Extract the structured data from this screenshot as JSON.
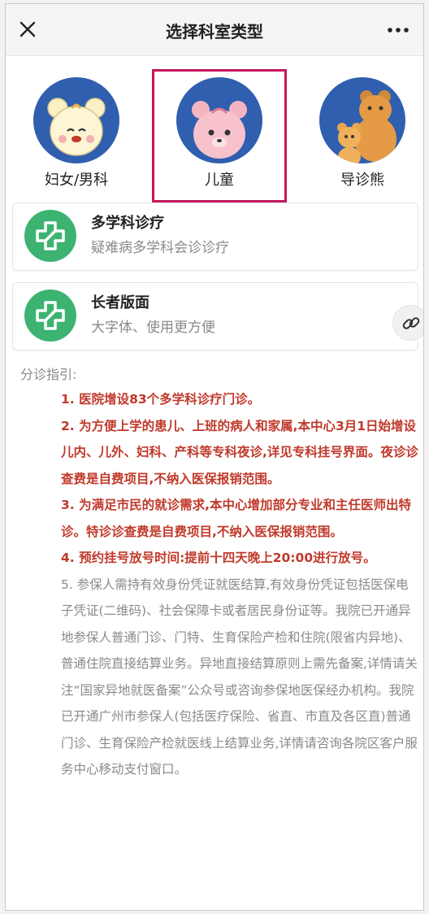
{
  "header": {
    "title": "选择科室类型",
    "close_icon": "close-icon",
    "more_icon": "more-icon"
  },
  "departments": [
    {
      "label": "妇女/男科",
      "selected": false
    },
    {
      "label": "儿童",
      "selected": true
    },
    {
      "label": "导诊熊",
      "selected": false
    }
  ],
  "cards": [
    {
      "title": "多学科诊疗",
      "subtitle": "疑难病多学科会诊诊疗",
      "icon": "medical-cross-icon"
    },
    {
      "title": "长者版面",
      "subtitle": "大字体、使用更方便",
      "icon": "medical-cross-icon"
    }
  ],
  "guide": {
    "heading": "分诊指引:",
    "items": [
      {
        "text": "1. 医院增设83个多学科诊疗门诊。",
        "style": "red"
      },
      {
        "text": "2. 为方便上学的患儿、上班的病人和家属,本中心3月1日始增设儿内、儿外、妇科、产科等专科夜诊,详见专科挂号界面。夜诊诊查费是自费项目,不纳入医保报销范围。",
        "style": "red"
      },
      {
        "text": "3. 为满足市民的就诊需求,本中心增加部分专业和主任医师出特诊。特诊诊查费是自费项目,不纳入医保报销范围。",
        "style": "red"
      },
      {
        "text": "4. 预约挂号放号时间:提前十四天晚上20:00进行放号。",
        "style": "red"
      },
      {
        "text": "5. 参保人需持有效身份凭证就医结算,有效身份凭证包括医保电子凭证(二维码)、社会保障卡或者居民身份证等。我院已开通异地参保人普通门诊、门特、生育保险产检和住院(限省内异地)、普通住院直接结算业务。异地直接结算原则上需先备案,详情请关注“国家异地就医备案”公众号或咨询参保地医保经办机构。我院已开通广州市参保人(包括医疗保险、省直、市直及各区直)普通门诊、生育保险产检就医线上结算业务,详情请咨询各院区客户服务中心移动支付窗口。",
        "style": "gray"
      }
    ]
  },
  "colors": {
    "selected_border": "#c2185b",
    "avatar_bg": "#2f5fae",
    "card_icon_bg": "#3cb371",
    "notice_red": "#c0392b",
    "notice_gray": "#8a8a8a"
  }
}
